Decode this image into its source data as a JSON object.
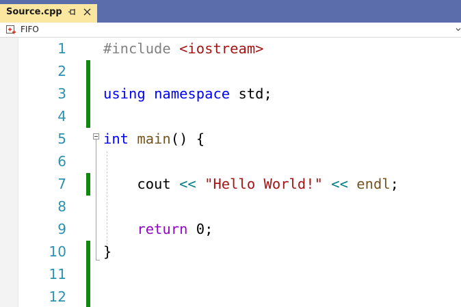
{
  "tab": {
    "title": "Source.cpp",
    "pin_icon": "pin-icon",
    "close_icon": "close-icon"
  },
  "navbar": {
    "icon": "project-icon",
    "label": "FIFO",
    "chevron_icon": "chevron-down-icon"
  },
  "editor": {
    "line_numbers": [
      "1",
      "2",
      "3",
      "4",
      "5",
      "6",
      "7",
      "8",
      "9",
      "10",
      "11",
      "12"
    ],
    "lines": {
      "l1": {
        "directive": "#include",
        "space": " ",
        "header": "<iostream>"
      },
      "l3": {
        "kw_using": "using",
        "s1": " ",
        "kw_namespace": "namespace",
        "s2": " ",
        "ns_name": "std",
        "semi": ";"
      },
      "l5": {
        "kw_int": "int",
        "s1": " ",
        "fn_name": "main",
        "parens": "()",
        "s2": " ",
        "brace_open": "{"
      },
      "l7": {
        "indent": "    ",
        "cout": "cout",
        "s1": " ",
        "op1": "<<",
        "s2": " ",
        "str": "\"Hello World!\"",
        "s3": " ",
        "op2": "<<",
        "s4": " ",
        "endl": "endl",
        "semi": ";"
      },
      "l9": {
        "indent": "    ",
        "kw_return": "return",
        "s1": " ",
        "num": "0",
        "semi": ";"
      },
      "l10": {
        "brace_close": "}"
      }
    },
    "modified_lines": [
      2,
      3,
      4,
      7,
      10,
      11,
      12
    ]
  },
  "colors": {
    "tabstrip_bg": "#5b6eab",
    "active_tab_bg": "#fbe7a0",
    "line_number": "#2b91af",
    "keyword": "#0000ff",
    "string": "#a31515",
    "control_keyword": "#8f08c4",
    "function": "#74531f",
    "operator": "#008080",
    "preprocessor": "#808080",
    "change_bar": "#108810"
  }
}
